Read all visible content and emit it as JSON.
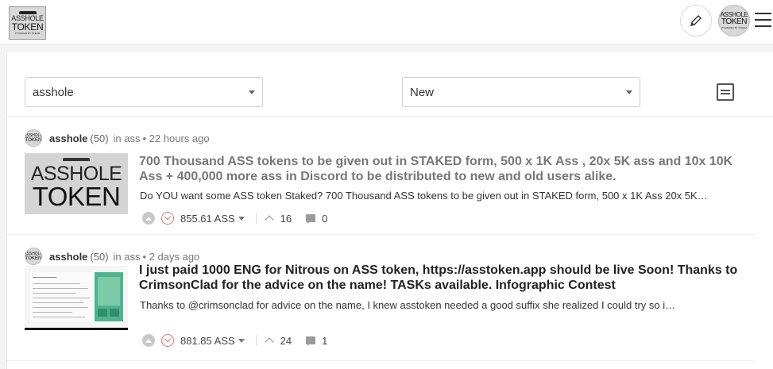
{
  "header": {
    "logo": {
      "line1": "ASSHOLE",
      "line2": "TOKEN",
      "line3": "POWERED BY STEEM"
    },
    "avatar": {
      "line1": "ASSHOLE",
      "line2": "TOKEN",
      "line3": "POWERED BY STEEM"
    },
    "icons": {
      "edit": "pencil-icon",
      "menu": "hamburger-icon"
    }
  },
  "filters": {
    "tag": "asshole",
    "sort": "New"
  },
  "posts": [
    {
      "author": "asshole",
      "reputation": "(50)",
      "category": "in ass",
      "time": "• 22 hours ago",
      "thumbnail": {
        "line1": "ASSHOLE",
        "line2": "TOKEN"
      },
      "title": "700 Thousand ASS tokens to be given out in STAKED form, 500 x 1K Ass , 20x 5K ass and 10x 10K Ass + 400,000 more ass in Discord to be distributed to new and old users alike.",
      "excerpt": "Do YOU want some ASS token Staked? 700 Thousand ASS tokens to be given out in STAKED form, 500 x 1K Ass 20x 5K…",
      "payout": "855.61 ASS",
      "votes": "16",
      "comments": "0"
    },
    {
      "author": "asshole",
      "reputation": "(50)",
      "category": "in ass",
      "time": "• 2 days ago",
      "title": "I just paid 1000 ENG for Nitrous on ASS token, https://asstoken.app should be live Soon! Thanks to CrimsonClad for the advice on the name! TASKs available. Infographic Contest",
      "excerpt": "Thanks to @crimsonclad for advice on the name, I knew asstoken needed a good suffix she realized I could try so i…",
      "payout": "881.85 ASS",
      "votes": "24",
      "comments": "1"
    }
  ]
}
